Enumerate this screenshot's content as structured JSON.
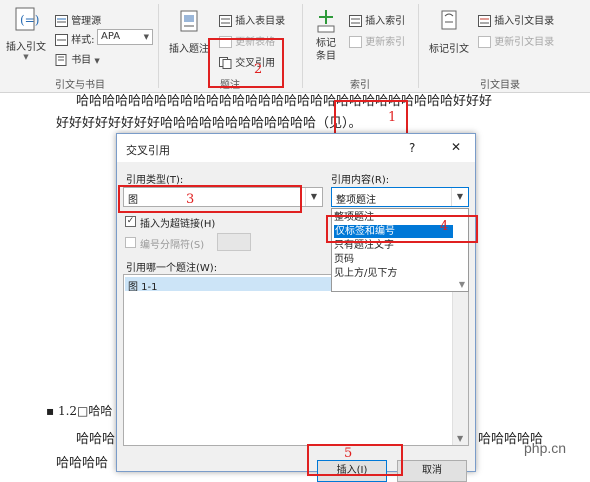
{
  "ribbon": {
    "insert_citation": "插入引文",
    "manage_sources": "管理源",
    "style_label": "样式:",
    "style_value": "APA",
    "bibliography": "书目",
    "group_citations": "引文与书目",
    "insert_caption": "插入题注",
    "insert_table_of_figures": "插入表目录",
    "update_table": "更新表格",
    "cross_reference": "交叉引用",
    "group_captions": "题注",
    "mark_entry": "标记条目",
    "insert_index": "插入索引",
    "update_index": "更新索引",
    "group_index": "索引",
    "mark_citation": "标记引文",
    "insert_toa": "插入引文目录",
    "update_toa": "更新引文目录",
    "group_toa": "引文目录"
  },
  "document": {
    "line1": "哈哈哈哈哈哈哈哈哈哈哈哈哈哈哈哈哈哈哈哈哈哈哈哈哈哈哈哈哈好好好",
    "line2": "好好好好好好好好哈哈哈哈哈哈哈哈哈哈哈哈（见）。",
    "heading": "1.2□哈哈⁠",
    "line3": "哈哈哈",
    "line3_right": "哈哈哈哈哈",
    "line4": "哈哈哈哈"
  },
  "annotations": [
    "1",
    "2",
    "3",
    "4",
    "5"
  ],
  "dialog": {
    "title": "交叉引用",
    "help": "?",
    "close": "✕",
    "ref_type_label": "引用类型(T):",
    "ref_type_value": "图",
    "ref_content_label": "引用内容(R):",
    "ref_content_value": "整项题注",
    "insert_hyperlink": "插入为超链接(H)",
    "separate_numbers": "编号分隔符(S)",
    "for_which_label": "引用哪一个题注(W):",
    "captions": [
      "图 1-1"
    ],
    "dropdown_options": [
      "整项题注",
      "仅标签和编号",
      "只有题注文字",
      "页码",
      "见上方/见下方"
    ],
    "dropdown_selected_index": 1,
    "insert_button": "插入(I)",
    "cancel_button": "取消"
  },
  "watermark": "php.cn",
  "colors": {
    "accent": "#0078d7",
    "annotation_red": "#e02020",
    "ribbon_bg": "#f3f3f3"
  }
}
